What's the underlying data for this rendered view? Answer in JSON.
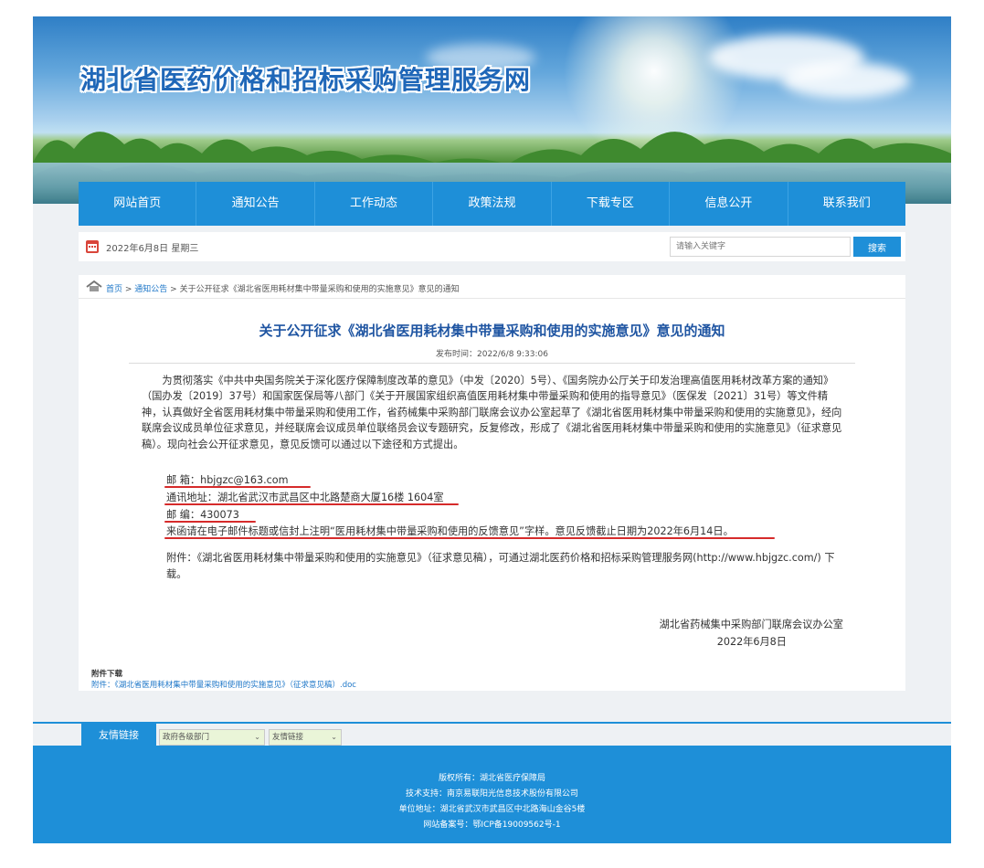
{
  "site": {
    "title": "湖北省医药价格和招标采购管理服务网"
  },
  "nav": [
    {
      "label": "网站首页"
    },
    {
      "label": "通知公告"
    },
    {
      "label": "工作动态"
    },
    {
      "label": "政策法规"
    },
    {
      "label": "下载专区"
    },
    {
      "label": "信息公开"
    },
    {
      "label": "联系我们"
    }
  ],
  "infobar": {
    "date": "2022年6月8日 星期三",
    "search_placeholder": "请输入关键字",
    "search_button": "搜索"
  },
  "breadcrumb": {
    "home": "首页",
    "sep1": " > ",
    "section": "通知公告",
    "sep2": " > ",
    "current": "关于公开征求《湖北省医用耗材集中带量采购和使用的实施意见》意见的通知"
  },
  "article": {
    "title": "关于公开征求《湖北省医用耗材集中带量采购和使用的实施意见》意见的通知",
    "publish_time": "发布时间：2022/6/8 9:33:06",
    "paragraph": "为贯彻落实《中共中央国务院关于深化医疗保障制度改革的意见》（中发〔2020〕5号）、《国务院办公厅关于印发治理高值医用耗材改革方案的通知》（国办发〔2019〕37号）和国家医保局等八部门《关于开展国家组织高值医用耗材集中带量采购和使用的指导意见》（医保发〔2021〕31号）等文件精神，认真做好全省医用耗材集中带量采购和使用工作，省药械集中采购部门联席会议办公室起草了《湖北省医用耗材集中带量采购和使用的实施意见》，经向联席会议成员单位征求意见，并经联席会议成员单位联络员会议专题研究，反复修改，形成了《湖北省医用耗材集中带量采购和使用的实施意见》（征求意见稿）。现向社会公开征求意见，意见反馈可以通过以下途径和方式提出。",
    "email_line": "邮    箱：hbjgzc@163.com",
    "address_line": "通讯地址：湖北省武汉市武昌区中北路楚商大厦16楼 1604室",
    "postcode_line": "邮    编：430073",
    "note_line": "来函请在电子邮件标题或信封上注明“医用耗材集中带量采购和使用的反馈意见”字样。意见反馈截止日期为2022年6月14日。",
    "attachment_note": "附件：《湖北省医用耗材集中带量采购和使用的实施意见》（征求意见稿），可通过湖北医药价格和招标采购管理服务网(http://www.hbjgzc.com/) 下载。",
    "signature": "湖北省药械集中采购部门联席会议办公室",
    "sign_date": "2022年6月8日",
    "download_title": "附件下载",
    "download_link": "附件：《湖北省医用耗材集中带量采购和使用的实施意见》（征求意见稿）.doc"
  },
  "links": {
    "tab": "友情链接",
    "select1": "政府各级部门",
    "select2": "友情链接"
  },
  "footer": {
    "line1": "版权所有：湖北省医疗保障局",
    "line2": "技术支持：南京易联阳光信息技术股份有限公司",
    "line3": "单位地址：湖北省武汉市武昌区中北路海山金谷5楼",
    "line4": "网站备案号：鄂ICP备19009562号-1"
  },
  "colors": {
    "accent": "#1e8fd8",
    "title_blue": "#1f55a2",
    "underline_red": "#d62b2b"
  }
}
